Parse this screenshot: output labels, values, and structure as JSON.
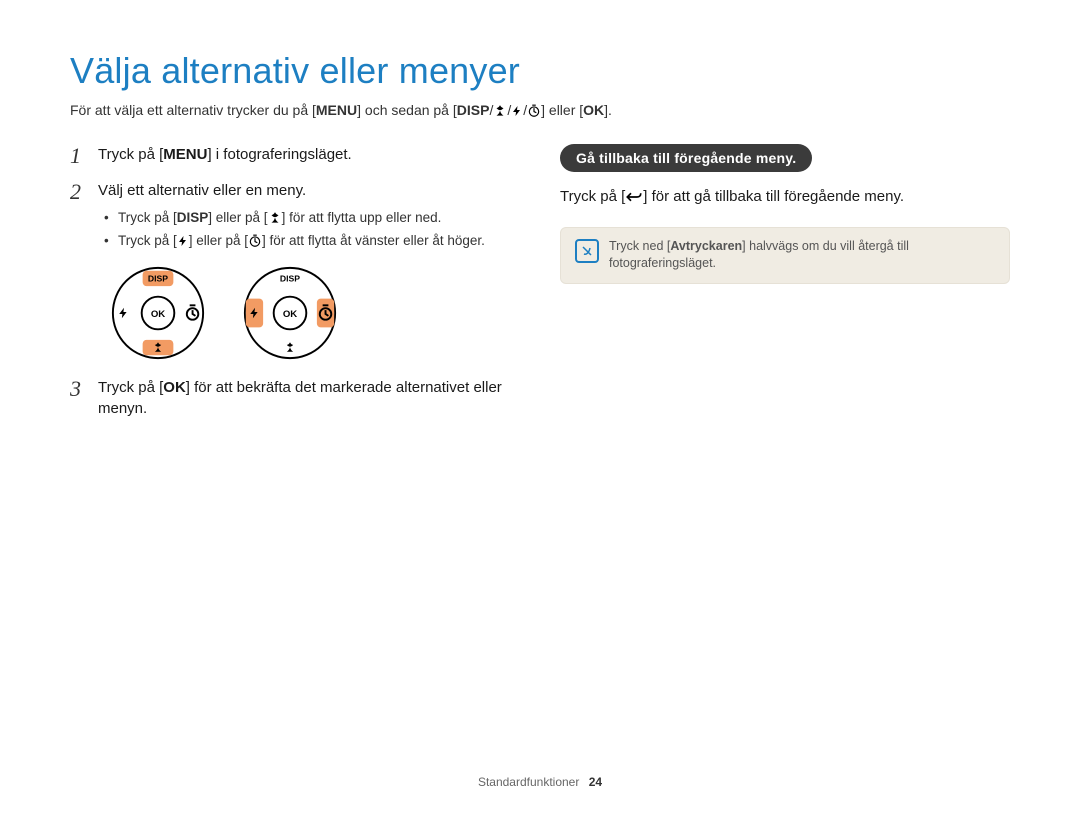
{
  "title": "Välja alternativ eller menyer",
  "intro": {
    "pre": "För att välja ett alternativ trycker du på [",
    "menu_label": "MENU",
    "mid1": "] och sedan på [",
    "disp_label": "DISP",
    "slash1": "/",
    "slash2": "/",
    "slash3": "/",
    "mid2": "] eller [",
    "ok_label": "OK",
    "post": "]."
  },
  "steps": {
    "s1": {
      "num": "1",
      "a": "Tryck på [",
      "menu_label": "MENU",
      "b": "] i fotograferingsläget."
    },
    "s2": {
      "num": "2",
      "text": "Välj ett alternativ eller en meny.",
      "bullets": {
        "b1": {
          "a": "Tryck på [",
          "disp_label": "DISP",
          "b": "] eller på [",
          "c": "] för att flytta upp eller ned."
        },
        "b2": {
          "a": "Tryck på [",
          "b": "] eller på [",
          "c": "] för att flytta åt vänster eller åt höger."
        }
      }
    },
    "s3": {
      "num": "3",
      "a": "Tryck på [",
      "ok_label": "OK",
      "b": "] för att bekräfta det markerade alternativet eller menyn."
    }
  },
  "dial_labels": {
    "disp": "DISP",
    "ok": "OK"
  },
  "right": {
    "pill": "Gå tillbaka till föregående meny.",
    "body": {
      "a": "Tryck på [",
      "b": "] för att gå tillbaka till föregående meny."
    }
  },
  "note": {
    "a": "Tryck ned [",
    "shutter_label": "Avtryckaren",
    "b": "] halvvägs om du vill återgå till fotograferingsläget."
  },
  "footer": {
    "section": "Standardfunktioner",
    "page": "24"
  }
}
